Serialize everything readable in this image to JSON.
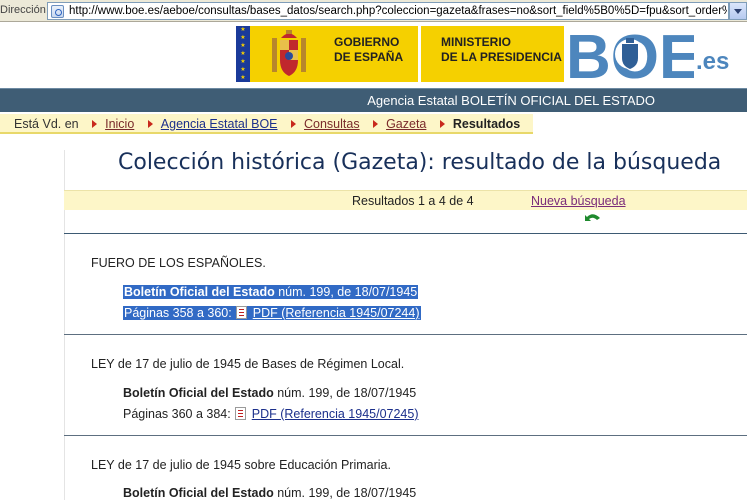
{
  "browser": {
    "address_label": "Dirección",
    "url": "http://www.boe.es/aeboe/consultas/bases_datos/search.php?coleccion=gazeta&frases=no&sort_field%5B0%5D=fpu&sort_order%"
  },
  "header": {
    "gob_line1": "GOBIERNO",
    "gob_line2": "DE ESPAÑA",
    "min_line1": "MINISTERIO",
    "min_line2": "DE LA PRESIDENCIA",
    "boe_logo_text": "BOE",
    "boe_suffix": ".es",
    "agency_title": "Agencia Estatal BOLETÍN OFICIAL DEL ESTADO",
    "brand_yellow": "#f5d000",
    "brand_blue": "#3f5d75"
  },
  "breadcrumb": {
    "lead": "Está Vd. en",
    "items": [
      "Inicio",
      "Agencia Estatal BOE",
      "Consultas",
      "Gazeta"
    ],
    "current": "Resultados"
  },
  "main": {
    "title": "Colección histórica (Gazeta): resultado de la búsqueda",
    "results_count": "Resultados 1 a 4 de 4",
    "new_search": "Nueva búsqueda",
    "back_icon": "back-arrow-icon"
  },
  "results": [
    {
      "title": "FUERO DE LOS ESPAÑOLES.",
      "publication": "Boletín Oficial del Estado",
      "issue": "núm. 199, de 18/07/1945",
      "pages": "Páginas 358 a 360:",
      "pdf_label": "PDF (Referencia 1945/07244)"
    },
    {
      "title": "LEY de 17 de julio de 1945 de Bases de Régimen Local.",
      "publication": "Boletín Oficial del Estado",
      "issue": "núm. 199, de 18/07/1945",
      "pages": "Páginas 360 a 384:",
      "pdf_label": "PDF (Referencia 1945/07245)"
    },
    {
      "title": "LEY de 17 de julio de 1945 sobre Educación Primaria.",
      "publication": "Boletín Oficial del Estado",
      "issue": "núm. 199, de 18/07/1945"
    }
  ]
}
